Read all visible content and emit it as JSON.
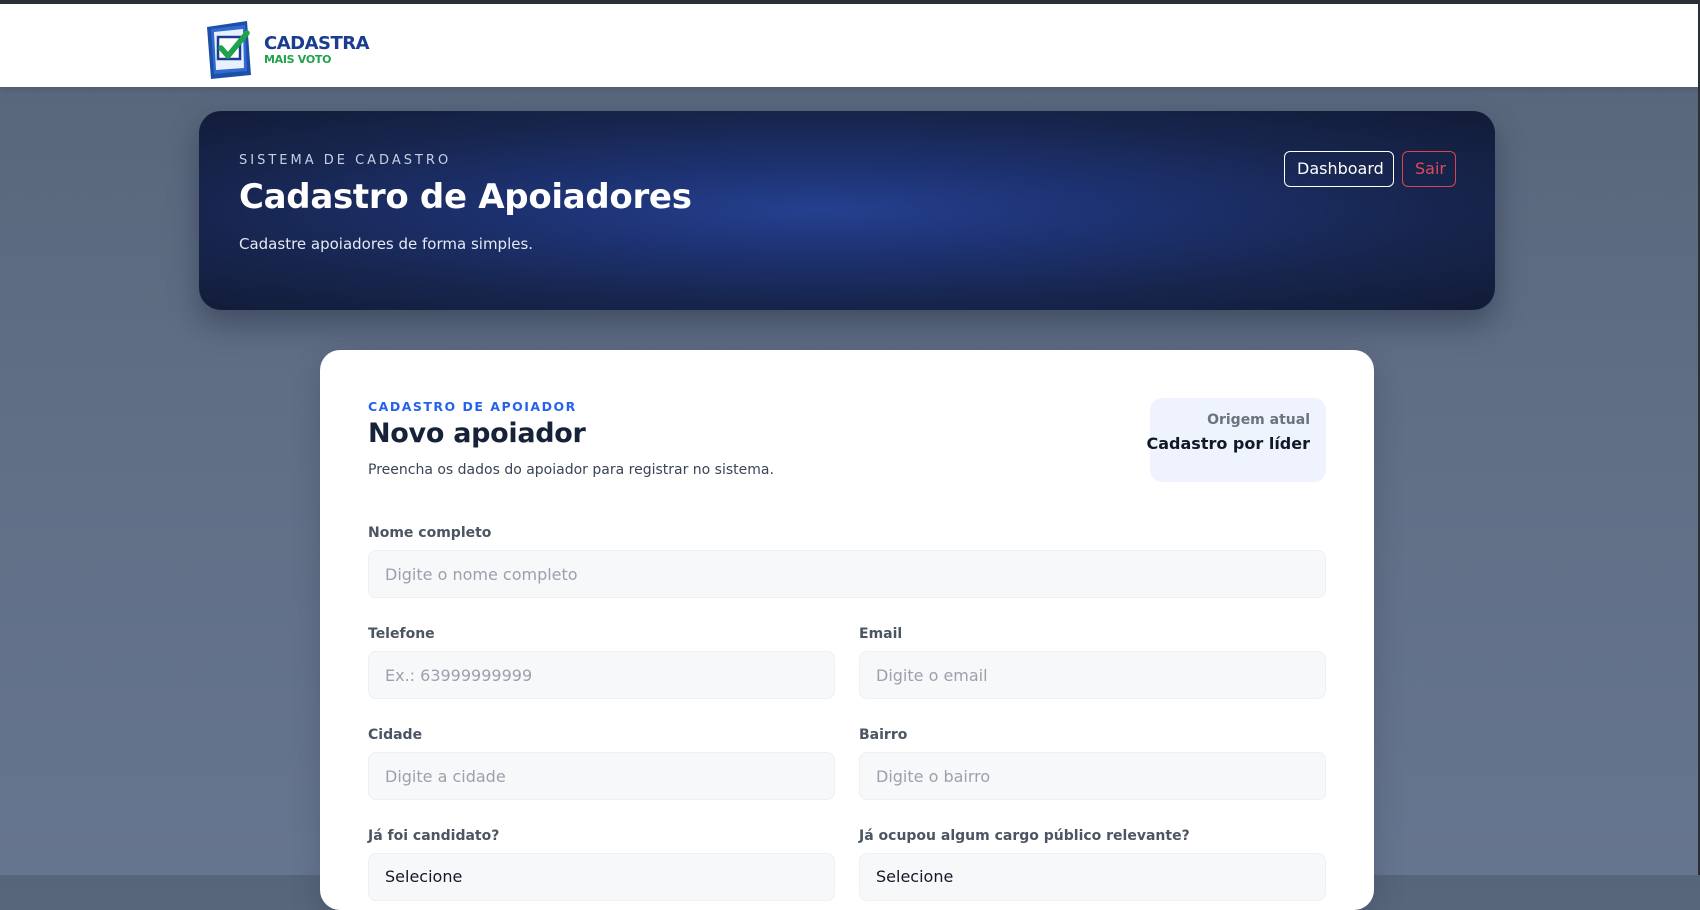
{
  "navbar": {
    "logo_line1": "CADASTRA",
    "logo_line2": "MAIS VOTO"
  },
  "hero": {
    "eyebrow": "SISTEMA DE CADASTRO",
    "title": "Cadastro de Apoiadores",
    "subtitle": "Cadastre apoiadores de forma simples.",
    "dashboard_label": "Dashboard",
    "logout_label": "Sair"
  },
  "form": {
    "eyebrow": "CADASTRO DE APOIADOR",
    "title": "Novo apoiador",
    "subtitle": "Preencha os dados do apoiador para registrar no sistema.",
    "origin": {
      "label": "Origem atual",
      "value": "Cadastro por líder"
    },
    "fields": {
      "nome": {
        "label": "Nome completo",
        "placeholder": "Digite o nome completo"
      },
      "telefone": {
        "label": "Telefone",
        "placeholder": "Ex.: 63999999999"
      },
      "email": {
        "label": "Email",
        "placeholder": "Digite o email"
      },
      "cidade": {
        "label": "Cidade",
        "placeholder": "Digite a cidade"
      },
      "bairro": {
        "label": "Bairro",
        "placeholder": "Digite o bairro"
      },
      "candidato": {
        "label": "Já foi candidato?",
        "value": "Selecione"
      },
      "cargo": {
        "label": "Já ocupou algum cargo público relevante?",
        "value": "Selecione"
      }
    }
  },
  "colors": {
    "accent": "#2563eb",
    "danger": "#e04a56",
    "hero_bg": "#1d3272"
  }
}
